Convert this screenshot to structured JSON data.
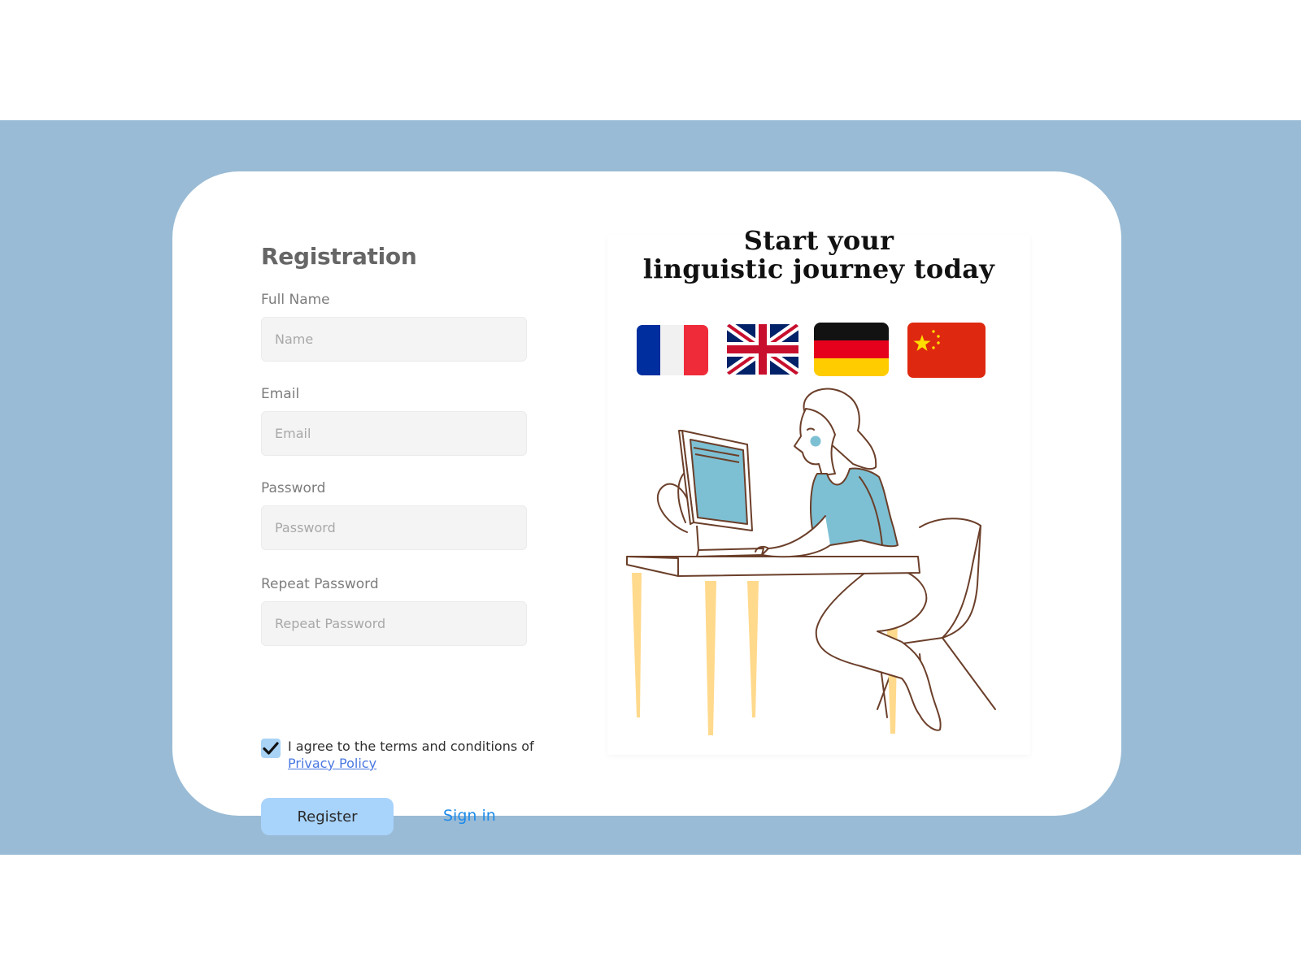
{
  "registration": {
    "title": "Registration",
    "fields": [
      {
        "label": "Full Name",
        "placeholder": "Name",
        "value": ""
      },
      {
        "label": "Email",
        "placeholder": "Email",
        "value": ""
      },
      {
        "label": "Password",
        "placeholder": "Password",
        "value": ""
      },
      {
        "label": "Repeat Password",
        "placeholder": "Repeat Password",
        "value": ""
      }
    ],
    "agree": {
      "checked": true,
      "text": "I agree to the terms and conditions of",
      "link_text": "Privacy Policy"
    },
    "register_label": "Register",
    "signin_label": "Sign in"
  },
  "promo": {
    "headline_line1": "Start your",
    "headline_line2": "linguistic journey today",
    "flags": [
      "france-flag-icon",
      "uk-flag-icon",
      "germany-flag-icon",
      "china-flag-icon"
    ],
    "illustration": "woman-at-computer-illustration"
  },
  "colors": {
    "band": "#99bbd5",
    "card": "#ffffff",
    "input_bg": "#f4f4f4",
    "register_bg": "#a8d3fb",
    "link": "#1f8bea",
    "privacy_link": "#4a78e0",
    "accent_blue": "#7dc0d3",
    "desk_leg": "#ffd98c"
  }
}
